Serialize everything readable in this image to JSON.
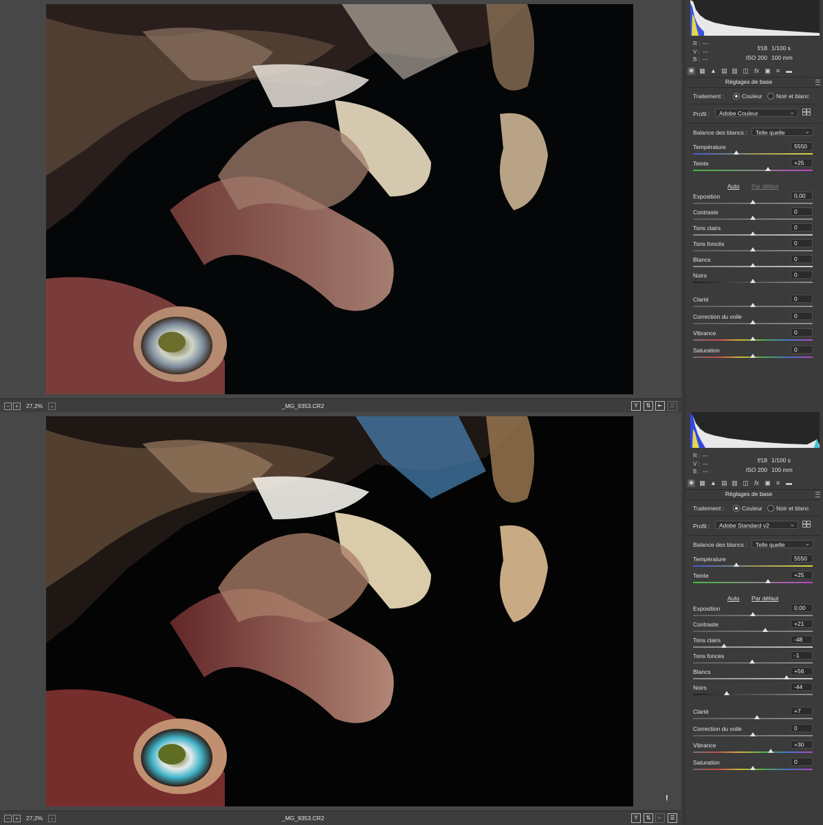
{
  "views": [
    {
      "id": "top",
      "statusbar": {
        "zoom": "27,2%",
        "filename": "_MG_9353.CR2"
      },
      "readout": {
        "r_label": "R :",
        "v_label": "V :",
        "b_label": "B :",
        "r": "---",
        "v": "---",
        "b": "---"
      },
      "camera": {
        "aperture": "f/18",
        "shutter": "1/100 s",
        "iso": "ISO 200",
        "focal": "100 mm"
      },
      "section_title": "Réglages de base",
      "traitement": {
        "label": "Traitement :",
        "couleur": "Couleur",
        "nb": "Noir et blanc",
        "selected": "Couleur"
      },
      "profil": {
        "label": "Profil :",
        "value": "Adobe Couleur"
      },
      "balance": {
        "label": "Balance des blancs :",
        "value": "Telle quelle"
      },
      "temperature": {
        "label": "Température",
        "value": "5550",
        "pos": 0.36
      },
      "teinte": {
        "label": "Teinte",
        "value": "+25",
        "pos": 0.625
      },
      "links": {
        "auto": "Auto",
        "default": "Par défaut",
        "default_enabled": false
      },
      "tone": [
        {
          "label": "Exposition",
          "value": "0,00",
          "pos": 0.5,
          "track": "gray"
        },
        {
          "label": "Contraste",
          "value": "0",
          "pos": 0.5,
          "track": "gray"
        },
        {
          "label": "Tons clairs",
          "value": "0",
          "pos": 0.5,
          "track": "light"
        },
        {
          "label": "Tons foncés",
          "value": "0",
          "pos": 0.5,
          "track": "gray"
        },
        {
          "label": "Blancs",
          "value": "0",
          "pos": 0.5,
          "track": "light"
        },
        {
          "label": "Noirs",
          "value": "0",
          "pos": 0.5,
          "track": "dark"
        }
      ],
      "presence": [
        {
          "label": "Clarté",
          "value": "0",
          "pos": 0.5,
          "track": "gray"
        },
        {
          "label": "Correction du voile",
          "value": "0",
          "pos": 0.5,
          "track": "gray"
        },
        {
          "label": "Vibrance",
          "value": "0",
          "pos": 0.5,
          "track": "vib"
        },
        {
          "label": "Saturation",
          "value": "0",
          "pos": 0.5,
          "track": "sat"
        }
      ]
    },
    {
      "id": "bottom",
      "statusbar": {
        "zoom": "27,2%",
        "filename": "_MG_9353.CR2",
        "warning": "!"
      },
      "readout": {
        "r_label": "R :",
        "v_label": "V :",
        "b_label": "B :",
        "r": "---",
        "v": "---",
        "b": "---"
      },
      "camera": {
        "aperture": "f/18",
        "shutter": "1/100 s",
        "iso": "ISO 200",
        "focal": "100 mm"
      },
      "section_title": "Réglages de base",
      "traitement": {
        "label": "Traitement :",
        "couleur": "Couleur",
        "nb": "Noir et blanc",
        "selected": "Couleur"
      },
      "profil": {
        "label": "Profil :",
        "value": "Adobe Standard v2"
      },
      "balance": {
        "label": "Balance des blancs :",
        "value": "Telle quelle"
      },
      "temperature": {
        "label": "Température",
        "value": "5550",
        "pos": 0.36
      },
      "teinte": {
        "label": "Teinte",
        "value": "+25",
        "pos": 0.625
      },
      "links": {
        "auto": "Auto",
        "default": "Par défaut",
        "default_enabled": true
      },
      "tone": [
        {
          "label": "Exposition",
          "value": "0,00",
          "pos": 0.5,
          "track": "gray"
        },
        {
          "label": "Contraste",
          "value": "+21",
          "pos": 0.605,
          "track": "gray"
        },
        {
          "label": "Tons clairs",
          "value": "-48",
          "pos": 0.26,
          "track": "light"
        },
        {
          "label": "Tons foncés",
          "value": "-1",
          "pos": 0.495,
          "track": "gray"
        },
        {
          "label": "Blancs",
          "value": "+56",
          "pos": 0.78,
          "track": "light"
        },
        {
          "label": "Noirs",
          "value": "-44",
          "pos": 0.28,
          "track": "dark"
        }
      ],
      "presence": [
        {
          "label": "Clarté",
          "value": "+7",
          "pos": 0.535,
          "track": "gray"
        },
        {
          "label": "Correction du voile",
          "value": "0",
          "pos": 0.5,
          "track": "gray"
        },
        {
          "label": "Vibrance",
          "value": "+30",
          "pos": 0.65,
          "track": "vib"
        },
        {
          "label": "Saturation",
          "value": "0",
          "pos": 0.5,
          "track": "sat"
        }
      ]
    }
  ],
  "icons": {
    "zoom_out": "minus-icon",
    "zoom_in": "plus-icon",
    "zoom_dropdown": "chevron-down-icon",
    "before_after": "y-toggle-icon",
    "swap": "swap-icon",
    "copy": "copy-settings-icon",
    "prefs": "sliders-icon",
    "tabs": [
      "aperture-icon",
      "tone-curve-icon",
      "detail-icon",
      "hsl-icon",
      "split-toning-icon",
      "lens-icon",
      "fx-icon",
      "calibration-icon",
      "presets-icon",
      "snapshots-icon"
    ]
  },
  "colors": {
    "panel_bg": "#3b3b3b",
    "viewer_bg": "#474747",
    "photo_bg": "#050607"
  }
}
